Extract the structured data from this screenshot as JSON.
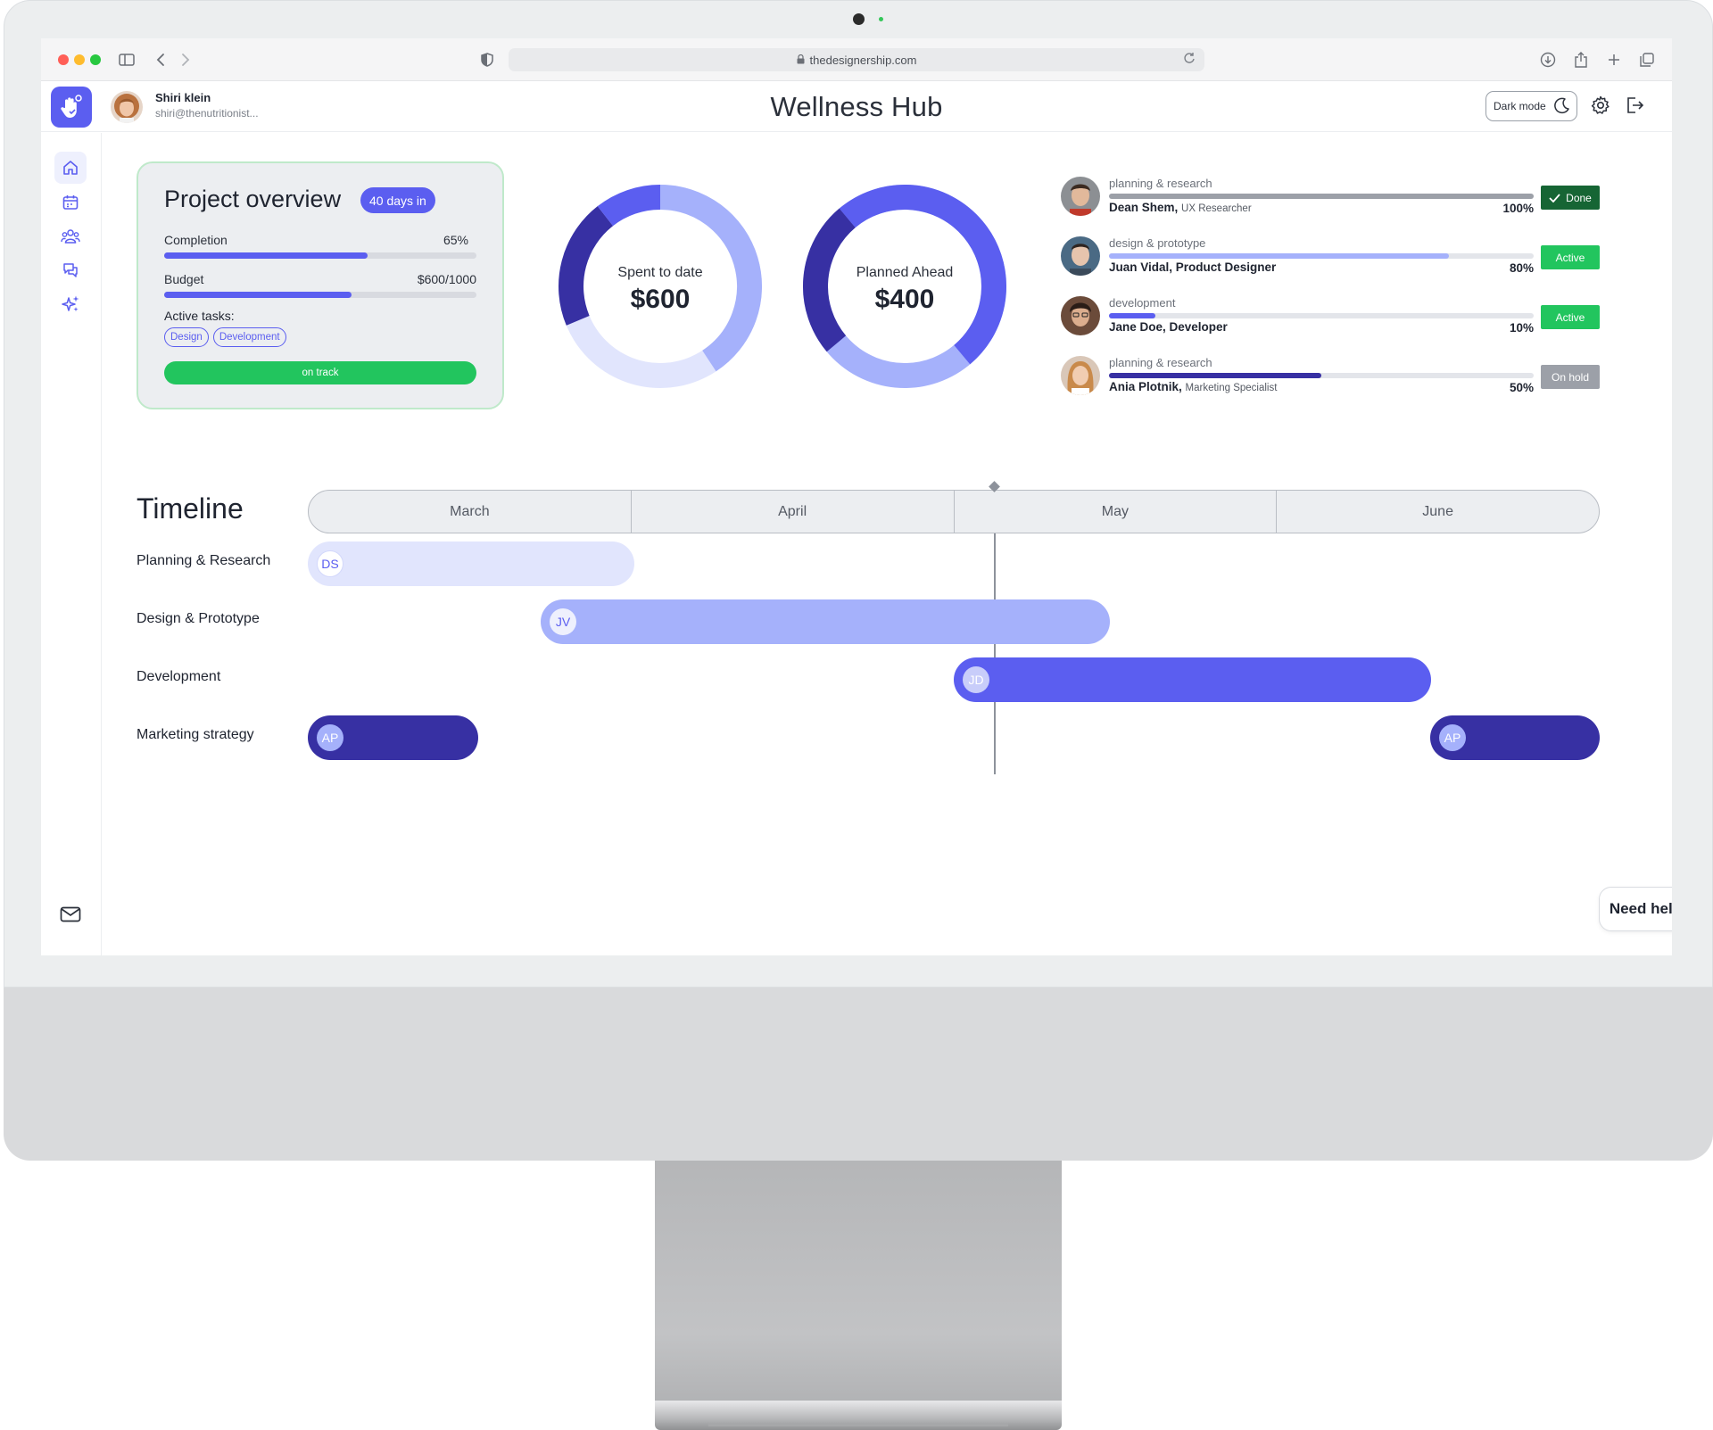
{
  "browser": {
    "url": "thedesignership.com"
  },
  "header": {
    "title": "Wellness Hub",
    "user_name": "Shiri klein",
    "user_email": "shiri@thenutritionist...",
    "dark_mode_label": "Dark mode"
  },
  "sidebar": {
    "items": [
      {
        "icon": "home-icon",
        "active": true
      },
      {
        "icon": "calendar-icon",
        "active": false
      },
      {
        "icon": "team-icon",
        "active": false
      },
      {
        "icon": "chat-icon",
        "active": false
      },
      {
        "icon": "sparkles-icon",
        "active": false
      }
    ],
    "bottom_icon": "mail-icon"
  },
  "overview": {
    "title": "Project overview",
    "badge": "40 days in",
    "completion_label": "Completion",
    "completion_value": "65%",
    "completion_fraction": 0.65,
    "budget_label": "Budget",
    "budget_value": "$600/1000",
    "budget_fraction": 0.6,
    "active_tasks_label": "Active tasks:",
    "tags": [
      "Design",
      "Development"
    ],
    "status": "on track"
  },
  "donuts": [
    {
      "label": "Spent to date",
      "value": "$600"
    },
    {
      "label": "Planned Ahead",
      "value": "$400"
    }
  ],
  "team": [
    {
      "task": "planning & research",
      "name": "Dean Shem,",
      "role": "UX Researcher",
      "percent": "100%",
      "progress": 1.0,
      "status": "Done",
      "status_color": "#166534",
      "bar_color": "#9ca0a8"
    },
    {
      "task": "design & prototype",
      "name": "Juan Vidal, Product Designer",
      "role": "",
      "percent": "80%",
      "progress": 0.8,
      "status": "Active",
      "status_color": "#22c55e",
      "bar_color": "#a5b1fb"
    },
    {
      "task": "development",
      "name": "Jane Doe, Developer",
      "role": "",
      "percent": "10%",
      "progress": 0.11,
      "status": "Active",
      "status_color": "#22c55e",
      "bar_color": "#5b5ef0"
    },
    {
      "task": "planning & research",
      "name": "Ania Plotnik,",
      "role": "Marketing Specialist",
      "percent": "50%",
      "progress": 0.5,
      "status": "On hold",
      "status_color": "#9ca0a8",
      "bar_color": "#3730a3"
    }
  ],
  "timeline": {
    "title": "Timeline",
    "months": [
      "March",
      "April",
      "May",
      "June"
    ],
    "rows": [
      {
        "label": "Planning & Research",
        "initials": "DS"
      },
      {
        "label": "Design & Prototype",
        "initials": "JV"
      },
      {
        "label": "Development",
        "initials": "JD"
      },
      {
        "label": "Marketing strategy",
        "initials": "AP"
      }
    ],
    "marketing_second_initials": "AP"
  },
  "help": {
    "label": "Need help ?"
  },
  "colors": {
    "accent": "#5b5ef0",
    "success": "#22c55e",
    "dark_indigo": "#3730a3",
    "light_indigo": "#a5b1fb",
    "pale_indigo": "#e1e5fd"
  }
}
